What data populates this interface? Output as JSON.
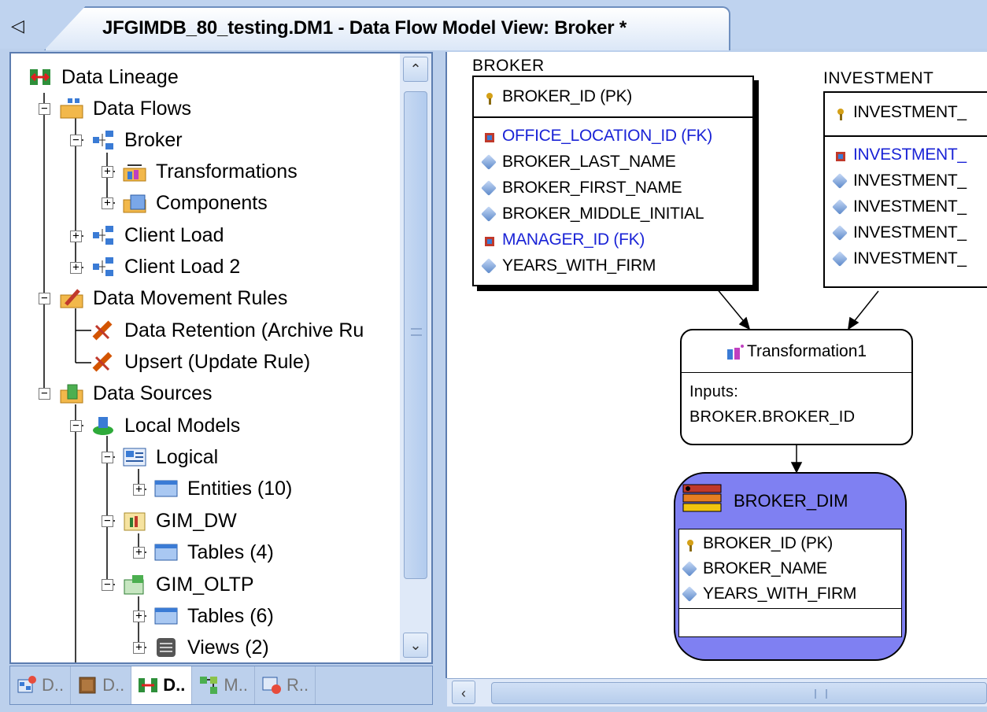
{
  "window": {
    "tab_title": "JFGIMDB_80_testing.DM1 - Data Flow Model View: Broker *",
    "tab_scroll_glyph": "◁"
  },
  "tree": {
    "items": [
      {
        "label": "Data Lineage",
        "icon": "data-lineage-icon"
      },
      {
        "label": "Data Flows",
        "icon": "data-flows-folder-icon"
      },
      {
        "label": "Broker",
        "icon": "data-flow-icon"
      },
      {
        "label": "Transformations",
        "icon": "transformations-icon"
      },
      {
        "label": "Components",
        "icon": "components-icon"
      },
      {
        "label": "Client Load",
        "icon": "data-flow-icon"
      },
      {
        "label": "Client Load 2",
        "icon": "data-flow-icon"
      },
      {
        "label": "Data Movement Rules",
        "icon": "rules-folder-icon"
      },
      {
        "label": "Data Retention (Archive Ru",
        "icon": "rule-icon"
      },
      {
        "label": "Upsert (Update Rule)",
        "icon": "rule-icon"
      },
      {
        "label": "Data Sources",
        "icon": "data-sources-icon"
      },
      {
        "label": "Local Models",
        "icon": "local-models-icon"
      },
      {
        "label": "Logical",
        "icon": "logical-model-icon"
      },
      {
        "label": "Entities (10)",
        "icon": "table-folder-icon"
      },
      {
        "label": "GIM_DW",
        "icon": "physical-model-icon"
      },
      {
        "label": "Tables (4)",
        "icon": "table-folder-icon"
      },
      {
        "label": "GIM_OLTP",
        "icon": "physical-model-icon"
      },
      {
        "label": "Tables (6)",
        "icon": "table-folder-icon"
      },
      {
        "label": "Views (2)",
        "icon": "views-icon"
      }
    ]
  },
  "bottom_tabs": [
    {
      "label": "D..",
      "icon": "data-model-tab-icon"
    },
    {
      "label": "D..",
      "icon": "dictionary-tab-icon"
    },
    {
      "label": "D..",
      "icon": "data-lineage-tab-icon"
    },
    {
      "label": "M..",
      "icon": "macro-tab-icon"
    },
    {
      "label": "R..",
      "icon": "repository-tab-icon"
    }
  ],
  "diagram": {
    "broker": {
      "title": "BROKER",
      "pk": "BROKER_ID (PK)",
      "attrs": [
        {
          "text": "OFFICE_LOCATION_ID (FK)",
          "fk": true
        },
        {
          "text": "BROKER_LAST_NAME",
          "fk": false
        },
        {
          "text": "BROKER_FIRST_NAME",
          "fk": false
        },
        {
          "text": "BROKER_MIDDLE_INITIAL",
          "fk": false
        },
        {
          "text": "MANAGER_ID (FK)",
          "fk": true
        },
        {
          "text": "YEARS_WITH_FIRM",
          "fk": false
        }
      ]
    },
    "investment": {
      "title": "INVESTMENT",
      "pk": "INVESTMENT_",
      "attrs": [
        {
          "text": "INVESTMENT_",
          "fk": true
        },
        {
          "text": "INVESTMENT_",
          "fk": false
        },
        {
          "text": "INVESTMENT_",
          "fk": false
        },
        {
          "text": "INVESTMENT_",
          "fk": false
        },
        {
          "text": "INVESTMENT_",
          "fk": false
        }
      ]
    },
    "transformation": {
      "title": "Transformation1",
      "inputs_label": "Inputs:",
      "inputs_value": "BROKER.BROKER_ID"
    },
    "broker_dim": {
      "title": "BROKER_DIM",
      "pk": "BROKER_ID (PK)",
      "attrs": [
        "BROKER_NAME",
        "YEARS_WITH_FIRM"
      ]
    }
  },
  "scroll": {
    "up": "⌃",
    "down": "⌄",
    "left": "‹"
  },
  "colors": {
    "fk_blue": "#1a23d6",
    "dim_fill": "#7f80f2",
    "panel_border": "#5c7db0"
  }
}
